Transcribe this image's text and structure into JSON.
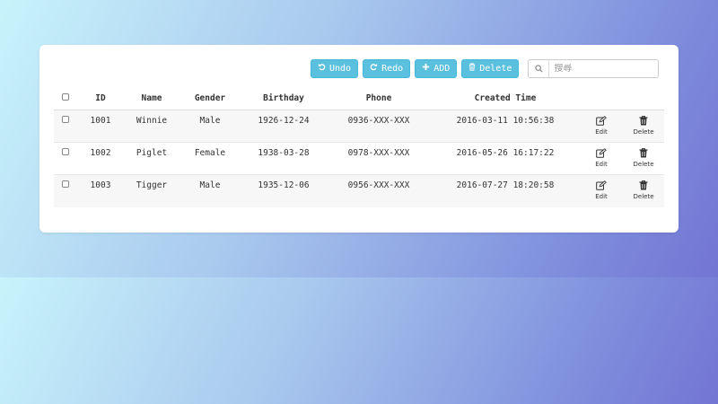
{
  "toolbar": {
    "undo_label": "Undo",
    "redo_label": "Redo",
    "add_label": "ADD",
    "delete_label": "Delete",
    "accent_color": "#5bc0de"
  },
  "search": {
    "placeholder": "搜尋",
    "value": ""
  },
  "table": {
    "headers": {
      "id": "ID",
      "name": "Name",
      "gender": "Gender",
      "birthday": "Birthday",
      "phone": "Phone",
      "created": "Created Time"
    },
    "rows": [
      {
        "id": "1001",
        "name": "Winnie",
        "gender": "Male",
        "birthday": "1926-12-24",
        "phone": "0936-XXX-XXX",
        "created": "2016-03-11 10:56:38"
      },
      {
        "id": "1002",
        "name": "Piglet",
        "gender": "Female",
        "birthday": "1938-03-28",
        "phone": "0978-XXX-XXX",
        "created": "2016-05-26 16:17:22"
      },
      {
        "id": "1003",
        "name": "Tigger",
        "gender": "Male",
        "birthday": "1935-12-06",
        "phone": "0956-XXX-XXX",
        "created": "2016-07-27 18:20:58"
      }
    ],
    "edit_label": "Edit",
    "delete_label": "Delete"
  },
  "icons": {
    "undo": "undo-icon",
    "redo": "redo-icon",
    "add": "plus-icon",
    "delete": "trash-icon",
    "search": "search-icon",
    "edit": "edit-icon"
  }
}
